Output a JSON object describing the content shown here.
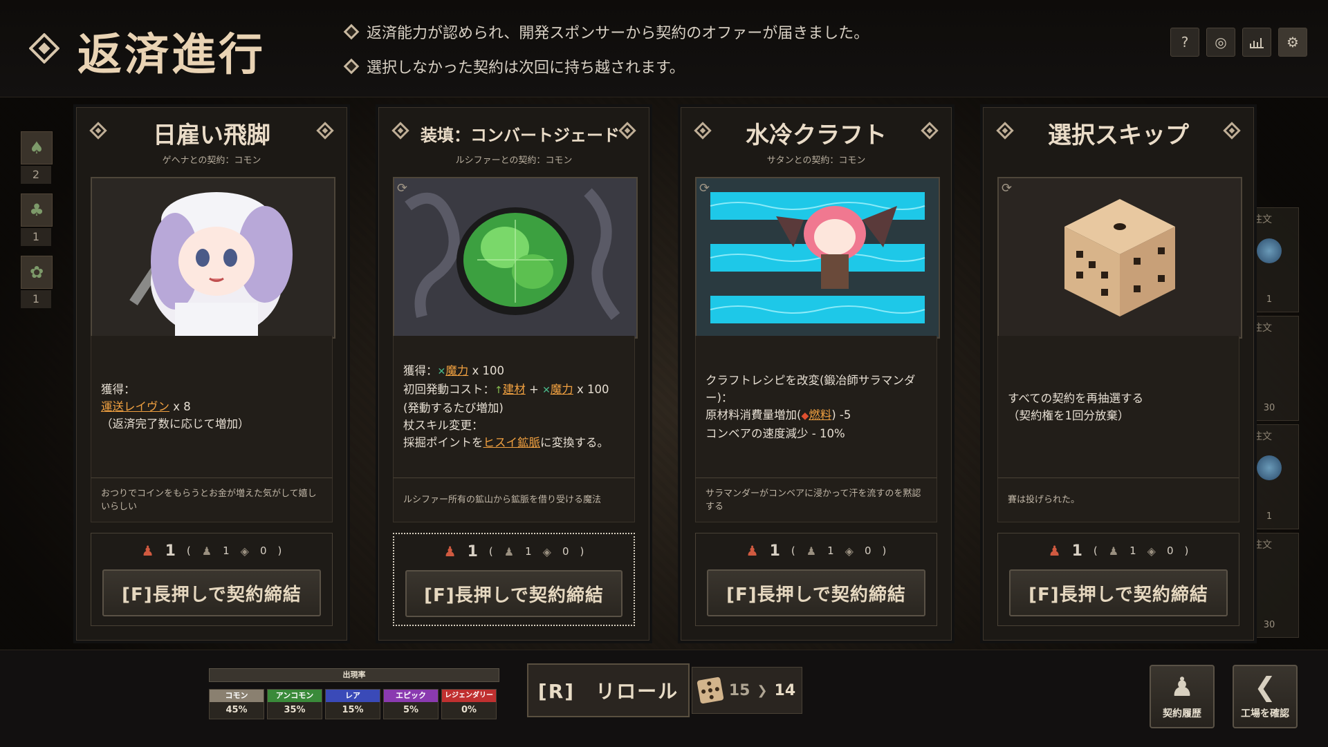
{
  "header": {
    "title": "返済進行",
    "messages": [
      "返済能力が認められ、開発スポンサーから契約のオファーが届きました。",
      "選択しなかった契約は次回に持ち越されます。"
    ]
  },
  "top_icons": [
    "help-icon",
    "target-icon",
    "stats-chart-icon",
    "settings-gear-icon"
  ],
  "sidebar": {
    "items": [
      {
        "icon": "mushroom-icon",
        "count": "2"
      },
      {
        "icon": "tree-icon",
        "count": "1"
      },
      {
        "icon": "plant-icon",
        "count": "1"
      }
    ]
  },
  "right_panel": {
    "items": [
      {
        "label": "の注文",
        "count": "1"
      },
      {
        "label": "の注文",
        "count": "30"
      },
      {
        "label": "の注文",
        "count": "1"
      },
      {
        "label": "の注文",
        "count": "30"
      }
    ]
  },
  "cards": [
    {
      "title": "日雇い飛脚",
      "subtitle": "ゲヘナとの契約：コモン",
      "desc": {
        "l1": "獲得：",
        "l2_link": "運送レイヴン",
        "l2_rest": " x 8",
        "l3": "（返済完了数に応じて増加）"
      },
      "flavor": "おつりでコインをもらうとお金が増えた気がして嬉しいらしい",
      "stats": {
        "main": "1",
        "sub1": "1",
        "sub2": "0"
      },
      "button": "[F]長押しで契約締結"
    },
    {
      "title": "装填：コンバートジェード",
      "subtitle": "ルシファーとの契約：コモン",
      "desc": {
        "l1_pre": "獲得：",
        "l1_link": "魔力",
        "l1_post": " x 100",
        "l2_pre": "初回発動コスト：",
        "l2_link1": "建材",
        "l2_mid": " + ",
        "l2_link2": "魔力",
        "l2_post": " x 100",
        "l3": "(発動するたび増加)",
        "l4": "杖スキル変更：",
        "l5_pre": "採掘ポイントを",
        "l5_link": "ヒスイ鉱脈",
        "l5_post": "に変換する。"
      },
      "flavor": "ルシファー所有の鉱山から鉱脈を借り受ける魔法",
      "stats": {
        "main": "1",
        "sub1": "1",
        "sub2": "0"
      },
      "button": "[F]長押しで契約締結"
    },
    {
      "title": "水冷クラフト",
      "subtitle": "サタンとの契約：コモン",
      "desc": {
        "l1": "クラフトレシピを改変(鍛冶師サラマンダー)：",
        "l2_pre": "原材料消費量増加(",
        "l2_link": "燃料",
        "l2_post": ") -5",
        "l3": "コンベアの速度減少 - 10%"
      },
      "flavor": "サラマンダーがコンベアに浸かって汗を流すのを黙認する",
      "stats": {
        "main": "1",
        "sub1": "1",
        "sub2": "0"
      },
      "button": "[F]長押しで契約締結"
    },
    {
      "title": "選択スキップ",
      "subtitle": "",
      "desc": {
        "l1": "すべての契約を再抽選する",
        "l2": "（契約権を1回分放棄）"
      },
      "flavor": "賽は投げられた。",
      "stats": {
        "main": "1",
        "sub1": "1",
        "sub2": "0"
      },
      "button": "[F]長押しで契約締結"
    }
  ],
  "rarity": {
    "header": "出現率",
    "items": [
      {
        "name": "コモン",
        "pct": "45%",
        "color": "#8a8070"
      },
      {
        "name": "アンコモン",
        "pct": "35%",
        "color": "#3a8a3a"
      },
      {
        "name": "レア",
        "pct": "15%",
        "color": "#3a4ab8"
      },
      {
        "name": "エピック",
        "pct": "5%",
        "color": "#8a3ab0"
      },
      {
        "name": "レジェンダリー",
        "pct": "0%",
        "color": "#c03030"
      }
    ]
  },
  "reroll": {
    "label": "[R]　リロール",
    "from": "15",
    "to": "14"
  },
  "bottom_buttons": {
    "history": "契約履歴",
    "factory": "工場を確認"
  },
  "colors": {
    "link": "#f0a040",
    "title": "#e9d3b4"
  }
}
